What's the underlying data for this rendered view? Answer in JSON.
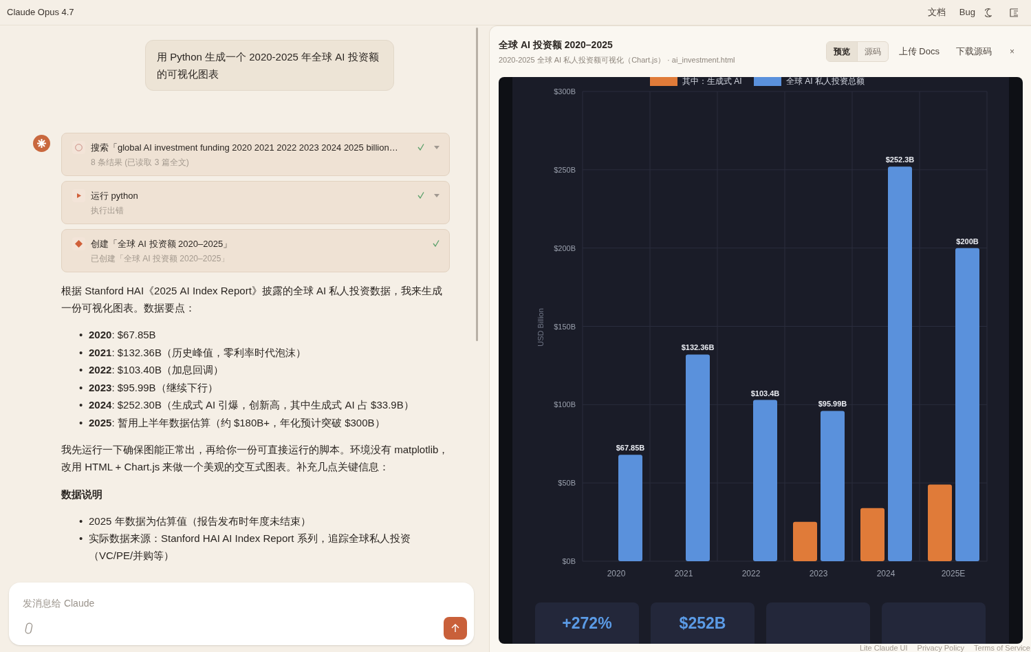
{
  "top_bar": {
    "model": "Claude Opus 4.7",
    "links": [
      "文档",
      "Bug"
    ]
  },
  "chat": {
    "user_message": "用 Python 生成一个 2020-2025 年全球 AI 投资额的可视化图表",
    "tool_calls": [
      {
        "kind": "search",
        "title": "搜索「global AI investment funding 2020 2021 2022 2023 2024 2025 billion…",
        "subtitle": "8 条结果 (已读取 3 篇全文)",
        "done": true,
        "expandable": true
      },
      {
        "kind": "run",
        "title": "运行 python",
        "subtitle": "执行出错",
        "done": true,
        "expandable": true
      },
      {
        "kind": "create",
        "title": "创建「全球 AI 投资额 2020–2025」",
        "subtitle": "已创建「全球 AI 投资额 2020–2025」",
        "done": true,
        "expandable": false
      }
    ],
    "marker": "•",
    "intro": "根据 Stanford HAI《2025 AI Index Report》披露的全球 AI 私人投资数据，我来生成一份可视化图表。数据要点：",
    "points": [
      "**2020**: $67.85B",
      "**2021**: $132.36B（历史峰值，零利率时代泡沫）",
      "**2022**: $103.40B（加息回调）",
      "**2023**: $95.99B（继续下行）",
      "**2024**: $252.30B（生成式 AI 引爆，创新高，其中生成式 AI 占 $33.9B）",
      "**2025**: 暂用上半年数据估算（约 $180B+，年化预计突破 $300B）"
    ],
    "paragraph": "我先运行一下确保图能正常出，再给你一份可直接运行的脚本。环境没有 matplotlib，改用 HTML + Chart.js 来做一个美观的交互式图表。补充几点关键信息：",
    "section_heading": "数据说明",
    "notes": [
      "2025 年数据为估算值（报告发布时年度未结束）",
      "实际数据来源：Stanford HAI AI Index Report 系列，追踪全球私人投资（VC/PE/并购等）"
    ]
  },
  "composer": {
    "placeholder": "发消息给 Claude"
  },
  "artifact": {
    "title": "全球 AI 投资额 2020–2025",
    "subtitle": "2020-2025 全球 AI 私人投资额可视化（Chart.js） · ai_investment.html",
    "tabs": [
      {
        "label": "预览",
        "selected": true
      },
      {
        "label": "源码",
        "selected": false
      }
    ],
    "actions": [
      "上传 Docs",
      "下载源码"
    ],
    "close": "×",
    "chart_data": {
      "type": "bar",
      "grid": true,
      "legend": true,
      "ylabel": "USD Billion",
      "categories": [
        "2020",
        "2021",
        "2022",
        "2023",
        "2024",
        "2025E"
      ],
      "series": [
        {
          "name": "其中：生成式 AI",
          "color": "#e07b39",
          "values": [
            null,
            null,
            null,
            25.2,
            33.9,
            49
          ]
        },
        {
          "name": "全球 AI 私人投资总额",
          "color": "#5a91dc",
          "values": [
            68,
            132,
            103,
            96,
            252,
            200
          ]
        }
      ],
      "ylim": [
        0,
        300
      ],
      "yticks": [
        {
          "value": 0,
          "label": "$0B"
        },
        {
          "value": 50,
          "label": "$50B"
        },
        {
          "value": 100,
          "label": "$100B"
        },
        {
          "value": 150,
          "label": "$150B"
        },
        {
          "value": 200,
          "label": "$200B"
        },
        {
          "value": 250,
          "label": "$250B"
        },
        {
          "value": 300,
          "label": "$300B"
        }
      ],
      "value_labels": [
        null,
        [
          "$67.85B",
          "$132.36B",
          "$103.4B",
          "$95.99B",
          "$252.3B",
          "$200B"
        ]
      ]
    },
    "stats": [
      "+272%",
      "$252B"
    ]
  },
  "footer": [
    "Lite Claude UI",
    "Privacy Policy",
    "Terms of Service"
  ]
}
